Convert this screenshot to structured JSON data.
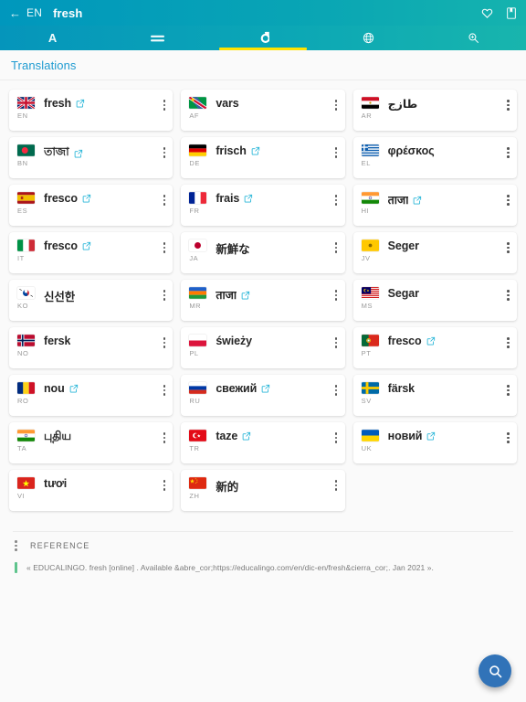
{
  "header": {
    "back_icon": "back-arrow-icon",
    "lang_code": "EN",
    "word": "fresh",
    "favorite_icon": "heart-icon",
    "bookmark_icon": "bookmark-icon"
  },
  "tabs": [
    {
      "name": "definition",
      "glyph": "A",
      "icon": "letter-a-icon",
      "active": false
    },
    {
      "name": "synonyms",
      "glyph": "≡",
      "icon": "equals-icon",
      "active": false
    },
    {
      "name": "translations",
      "glyph": "σ",
      "icon": "sigma-icon",
      "active": true
    },
    {
      "name": "languages",
      "glyph": "⊕",
      "icon": "globe-icon",
      "active": false
    },
    {
      "name": "search",
      "glyph": "⌕",
      "icon": "search-icon",
      "active": false
    }
  ],
  "section": {
    "title": "Translations"
  },
  "cards": [
    {
      "code": "EN",
      "word": "fresh",
      "flag": "gb",
      "external": true
    },
    {
      "code": "AF",
      "word": "vars",
      "flag": "na",
      "external": false
    },
    {
      "code": "AR",
      "word": "طازج",
      "flag": "eg",
      "external": false
    },
    {
      "code": "BN",
      "word": "তাজা",
      "flag": "bd",
      "external": true
    },
    {
      "code": "DE",
      "word": "frisch",
      "flag": "de",
      "external": true
    },
    {
      "code": "EL",
      "word": "φρέσκος",
      "flag": "gr",
      "external": false
    },
    {
      "code": "ES",
      "word": "fresco",
      "flag": "es",
      "external": true
    },
    {
      "code": "FR",
      "word": "frais",
      "flag": "fr",
      "external": true
    },
    {
      "code": "HI",
      "word": "ताजा",
      "flag": "in",
      "external": true
    },
    {
      "code": "IT",
      "word": "fresco",
      "flag": "it",
      "external": true
    },
    {
      "code": "JA",
      "word": "新鮮な",
      "flag": "jp",
      "external": false
    },
    {
      "code": "JV",
      "word": "Seger",
      "flag": "jv",
      "external": false
    },
    {
      "code": "KO",
      "word": "신선한",
      "flag": "kr",
      "external": false
    },
    {
      "code": "MR",
      "word": "ताजा",
      "flag": "mr",
      "external": true
    },
    {
      "code": "MS",
      "word": "Segar",
      "flag": "my",
      "external": false
    },
    {
      "code": "NO",
      "word": "fersk",
      "flag": "no",
      "external": false
    },
    {
      "code": "PL",
      "word": "świeży",
      "flag": "pl",
      "external": false
    },
    {
      "code": "PT",
      "word": "fresco",
      "flag": "pt",
      "external": true
    },
    {
      "code": "RO",
      "word": "nou",
      "flag": "ro",
      "external": true
    },
    {
      "code": "RU",
      "word": "свежий",
      "flag": "ru",
      "external": true
    },
    {
      "code": "SV",
      "word": "färsk",
      "flag": "se",
      "external": false
    },
    {
      "code": "TA",
      "word": "புதிய",
      "flag": "in",
      "external": false
    },
    {
      "code": "TR",
      "word": "taze",
      "flag": "tr",
      "external": true
    },
    {
      "code": "UK",
      "word": "новий",
      "flag": "ua",
      "external": true
    },
    {
      "code": "VI",
      "word": "tươi",
      "flag": "vn",
      "external": false
    },
    {
      "code": "ZH",
      "word": "新的",
      "flag": "cn",
      "external": false
    }
  ],
  "reference": {
    "title": "REFERENCE",
    "text": "« EDUCALINGO. fresh [online] . Available &abre_cor;https://educalingo.com/en/dic-en/fresh&cierra_cor;. Jan 2021 »."
  },
  "fab": {
    "icon": "search-icon",
    "color": "#3173b8"
  },
  "colors": {
    "topbar_left": "#0097bd",
    "topbar_right": "#15b3ae",
    "tab_indicator": "#ffe300",
    "section_title": "#1f9bd1",
    "external_link": "#29b6d8",
    "quote_bar": "#5fc48d",
    "fab": "#3173b8"
  }
}
